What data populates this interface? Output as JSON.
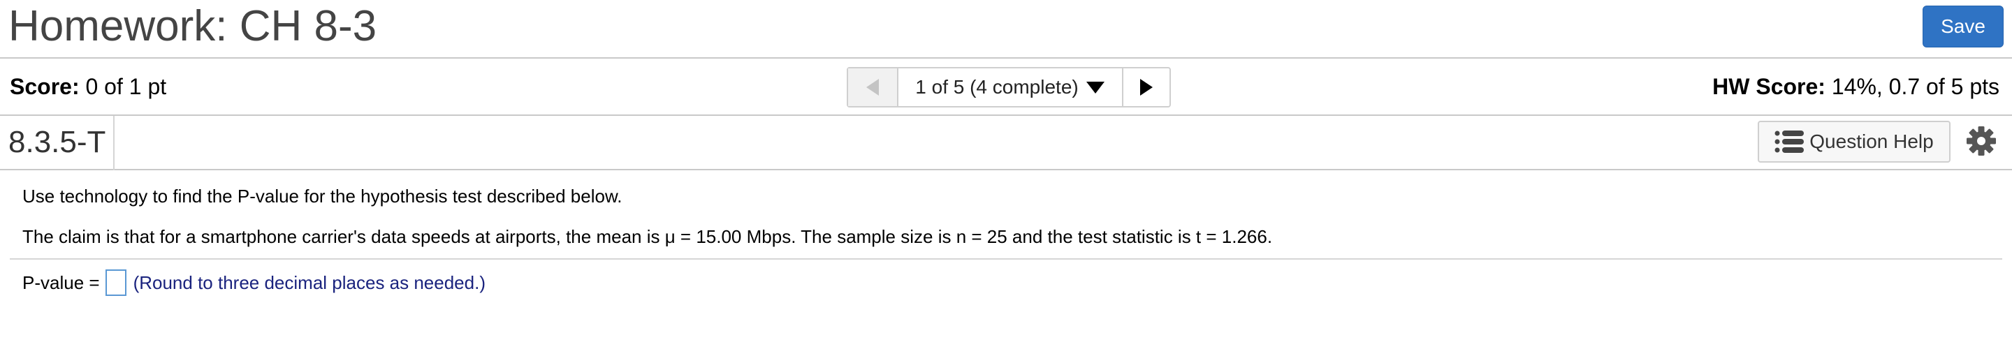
{
  "header": {
    "title": "Homework: CH 8-3",
    "save_label": "Save"
  },
  "score": {
    "label": "Score:",
    "value": "0 of 1 pt",
    "hw_label": "HW Score:",
    "hw_value": "14%, 0.7 of 5 pts"
  },
  "nav": {
    "status": "1 of 5 (4 complete)"
  },
  "question": {
    "id": "8.3.5-T",
    "help_label": "Question Help",
    "instruction": "Use technology to find the P-value for the hypothesis test described below.",
    "claim": "The claim is that for a smartphone carrier's data speeds at airports, the mean is μ = 15.00 Mbps. The sample size is n = 25 and the test statistic is t = 1.266.",
    "answer_label": "P-value =",
    "answer_value": "",
    "hint": "(Round to three decimal places as needed.)"
  },
  "icons": {
    "prev": "triangle-left-icon",
    "dropdown": "caret-down-icon",
    "next": "triangle-right-icon",
    "help": "list-icon",
    "settings": "gear-icon"
  },
  "colors": {
    "save_button": "#2f73c4",
    "hint_text": "#1a237e",
    "answer_box_border": "#5a98d4"
  }
}
